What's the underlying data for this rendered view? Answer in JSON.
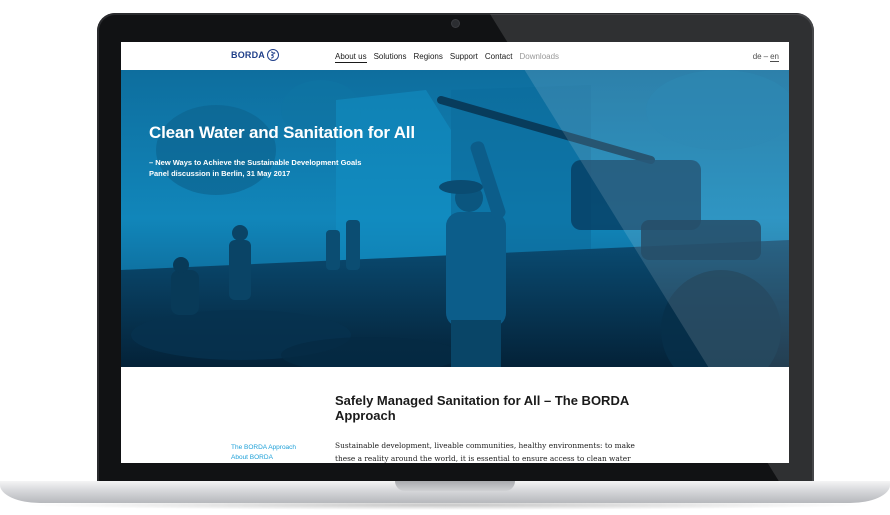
{
  "header": {
    "logo_text": "BORDA",
    "nav": [
      {
        "label": "About us",
        "active": true
      },
      {
        "label": "Solutions"
      },
      {
        "label": "Regions"
      },
      {
        "label": "Support"
      },
      {
        "label": "Contact"
      },
      {
        "label": "Downloads",
        "muted": true
      }
    ],
    "lang": {
      "de": "de",
      "sep": "–",
      "en": "en",
      "selected": "en"
    }
  },
  "hero": {
    "title": "Clean Water and Sanitation for All",
    "subtitle_line1": "– New Ways to Achieve the Sustainable Development Goals",
    "subtitle_line2": "Panel discussion in Berlin, 31 May 2017"
  },
  "content": {
    "title": "Safely Managed Sanitation for All – The BORDA Approach",
    "sidenav": [
      "The BORDA Approach",
      "About BORDA"
    ],
    "body_line1": "Sustainable development, liveable communities, healthy environments: to make",
    "body_line2": "these a reality around the world, it is essential to ensure access to clean water"
  },
  "colors": {
    "accent": "#1ea0d8",
    "logo": "#1f3f8a",
    "hero_blue": "#0b7bb0"
  }
}
